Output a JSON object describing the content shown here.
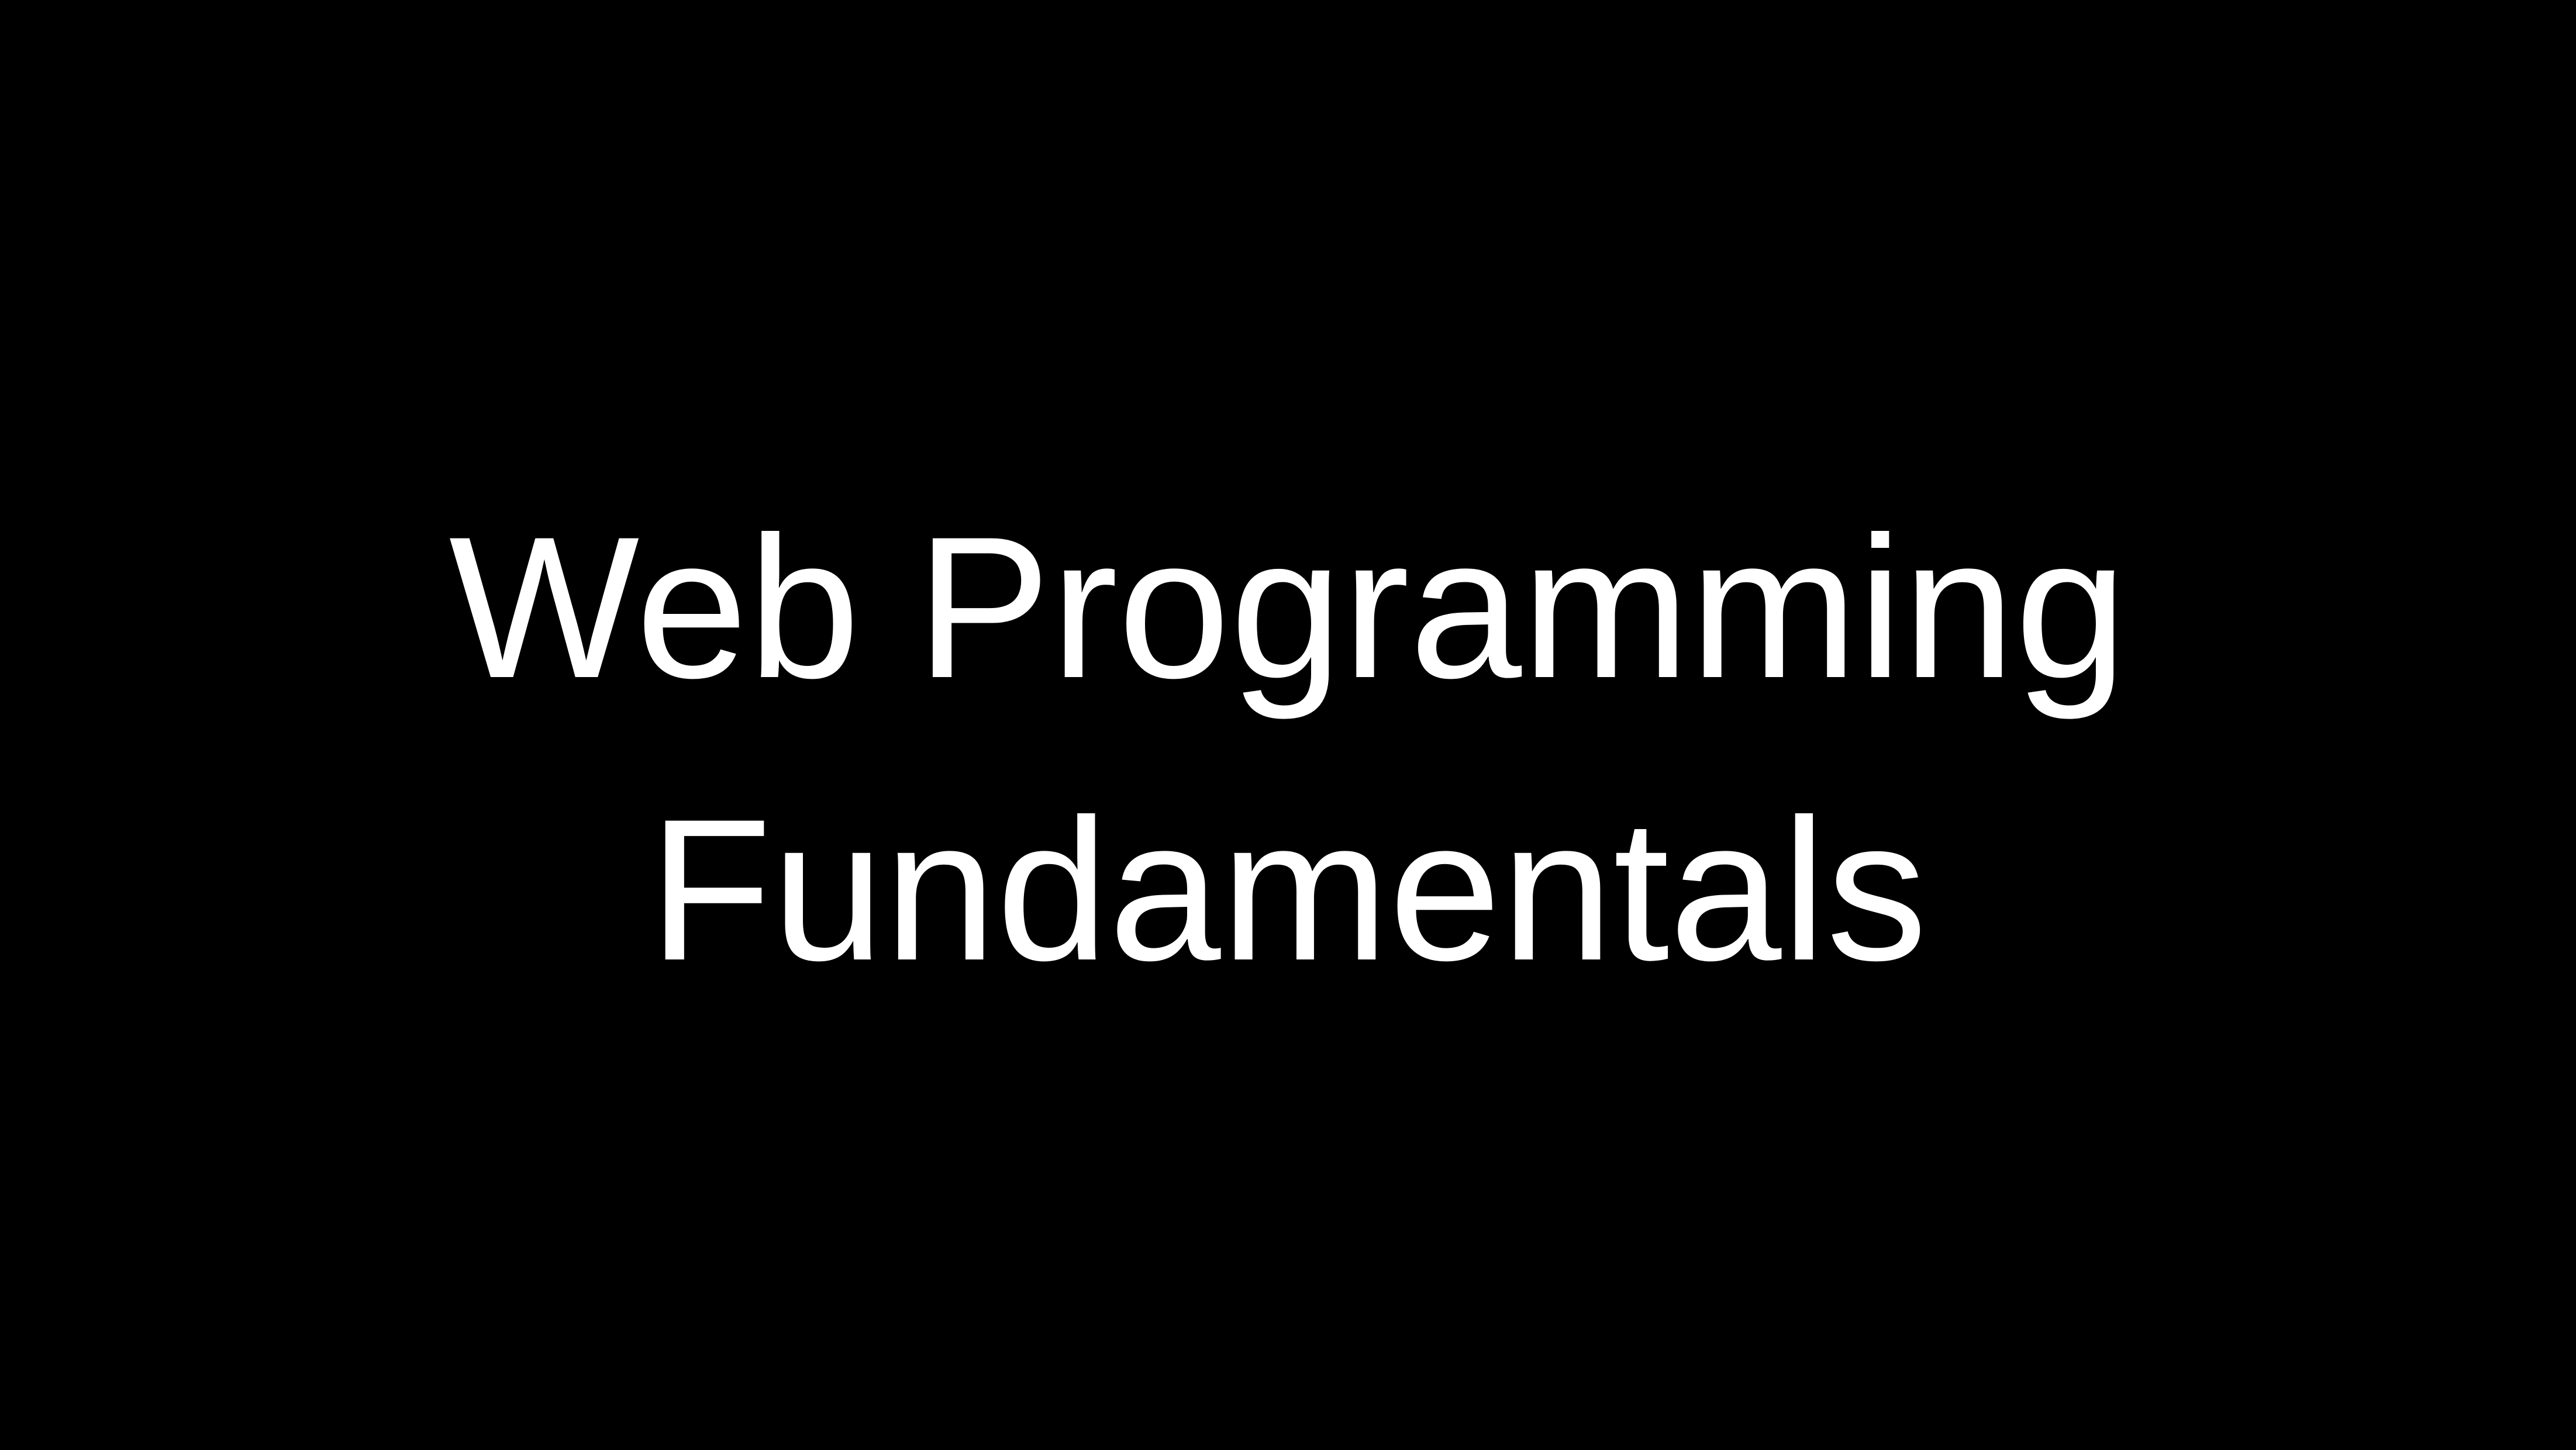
{
  "slide": {
    "title_lines": [
      "Web Programming",
      "Fundamentals"
    ]
  },
  "colors": {
    "background": "#000000",
    "text": "#ffffff"
  }
}
